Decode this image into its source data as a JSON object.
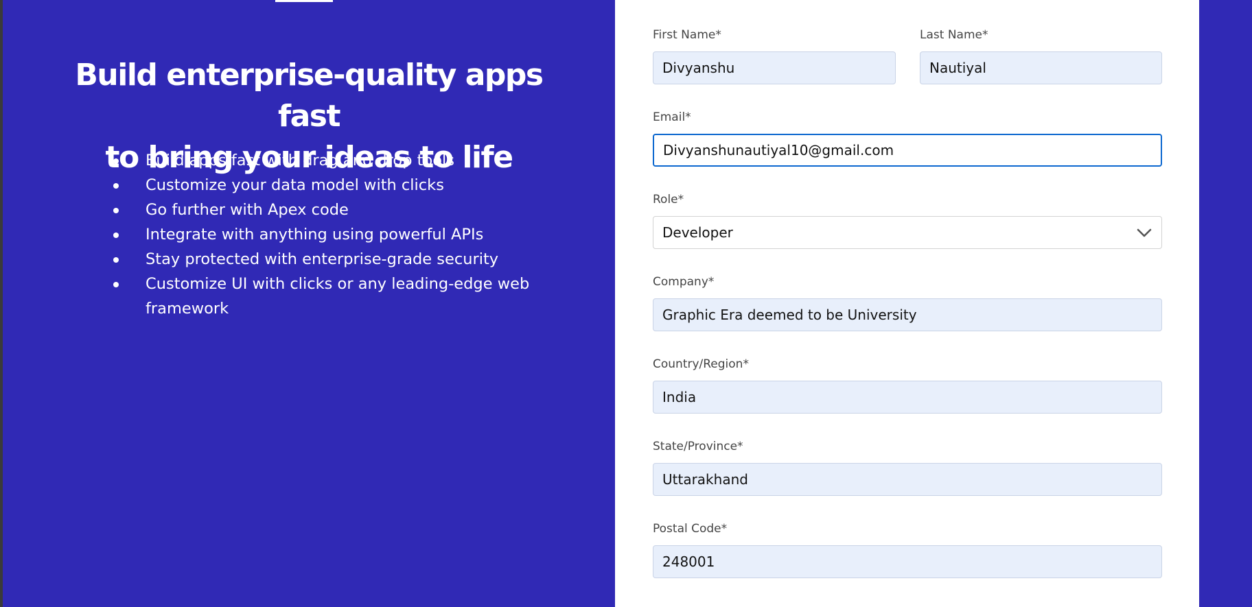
{
  "hero": {
    "title_line1": "Build enterprise-quality apps fast",
    "title_line2": "to bring your ideas to life",
    "features": [
      "Build apps fast with drag and drop tools",
      "Customize your data model with clicks",
      "Go further with Apex code",
      "Integrate with anything using powerful APIs",
      "Stay protected with enterprise-grade security",
      "Customize UI with clicks or any leading-edge web",
      "framework"
    ]
  },
  "form": {
    "first_name": {
      "label": "First Name*",
      "value": "Divyanshu"
    },
    "last_name": {
      "label": "Last Name*",
      "value": "Nautiyal"
    },
    "email": {
      "label": "Email*",
      "value": "Divyanshunautiyal10@gmail.com"
    },
    "role": {
      "label": "Role*",
      "value": "Developer",
      "icon": "chevron-down-icon"
    },
    "company": {
      "label": "Company*",
      "value": "Graphic Era deemed to be University"
    },
    "country": {
      "label": "Country/Region*",
      "value": "India"
    },
    "state": {
      "label": "State/Province*",
      "value": "Uttarakhand"
    },
    "postal_code": {
      "label": "Postal Code*",
      "value": "248001"
    }
  },
  "colors": {
    "background": "#3029b5",
    "card": "#ffffff",
    "input_fill": "#e8effb",
    "focus_border": "#0b67cf"
  }
}
